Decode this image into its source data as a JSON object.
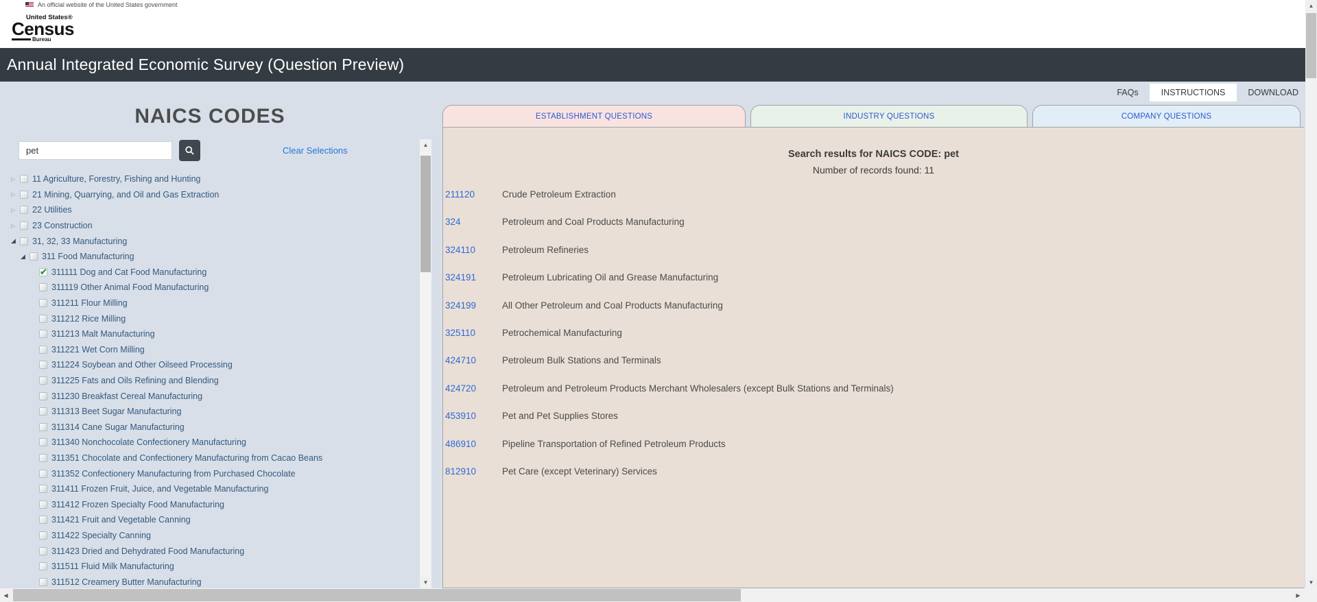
{
  "banner": {
    "text": "An official website of the United States government"
  },
  "logo": {
    "top": "United States®",
    "main": "Census",
    "sub": "Bureau"
  },
  "header": {
    "title": "Annual Integrated Economic Survey (Question Preview)"
  },
  "nav": {
    "links": [
      "FAQs",
      "INSTRUCTIONS",
      "DOWNLOAD"
    ]
  },
  "left_panel": {
    "title": "NAICS CODES",
    "search_value": "pet",
    "clear_label": "Clear Selections",
    "tree": [
      {
        "label": "11 Agriculture, Forestry, Fishing and Hunting",
        "level": 0,
        "expander": "collapsed",
        "checked": false
      },
      {
        "label": "21 Mining, Quarrying, and Oil and Gas Extraction",
        "level": 0,
        "expander": "collapsed",
        "checked": false
      },
      {
        "label": "22 Utilities",
        "level": 0,
        "expander": "collapsed",
        "checked": false
      },
      {
        "label": "23 Construction",
        "level": 0,
        "expander": "collapsed",
        "checked": false
      },
      {
        "label": "31, 32, 33 Manufacturing",
        "level": 0,
        "expander": "expanded",
        "checked": false
      },
      {
        "label": "311 Food Manufacturing",
        "level": 1,
        "expander": "expanded",
        "checked": false
      },
      {
        "label": "311111 Dog and Cat Food Manufacturing",
        "level": 2,
        "expander": null,
        "checked": true
      },
      {
        "label": "311119 Other Animal Food Manufacturing",
        "level": 2,
        "expander": null,
        "checked": false
      },
      {
        "label": "311211 Flour Milling",
        "level": 2,
        "expander": null,
        "checked": false
      },
      {
        "label": "311212 Rice Milling",
        "level": 2,
        "expander": null,
        "checked": false
      },
      {
        "label": "311213 Malt Manufacturing",
        "level": 2,
        "expander": null,
        "checked": false
      },
      {
        "label": "311221 Wet Corn Milling",
        "level": 2,
        "expander": null,
        "checked": false
      },
      {
        "label": "311224 Soybean and Other Oilseed Processing",
        "level": 2,
        "expander": null,
        "checked": false
      },
      {
        "label": "311225 Fats and Oils Refining and Blending",
        "level": 2,
        "expander": null,
        "checked": false
      },
      {
        "label": "311230 Breakfast Cereal Manufacturing",
        "level": 2,
        "expander": null,
        "checked": false
      },
      {
        "label": "311313 Beet Sugar Manufacturing",
        "level": 2,
        "expander": null,
        "checked": false
      },
      {
        "label": "311314 Cane Sugar Manufacturing",
        "level": 2,
        "expander": null,
        "checked": false
      },
      {
        "label": "311340 Nonchocolate Confectionery Manufacturing",
        "level": 2,
        "expander": null,
        "checked": false
      },
      {
        "label": "311351 Chocolate and Confectionery Manufacturing from Cacao Beans",
        "level": 2,
        "expander": null,
        "checked": false
      },
      {
        "label": "311352 Confectionery Manufacturing from Purchased Chocolate",
        "level": 2,
        "expander": null,
        "checked": false
      },
      {
        "label": "311411 Frozen Fruit, Juice, and Vegetable Manufacturing",
        "level": 2,
        "expander": null,
        "checked": false
      },
      {
        "label": "311412 Frozen Specialty Food Manufacturing",
        "level": 2,
        "expander": null,
        "checked": false
      },
      {
        "label": "311421 Fruit and Vegetable Canning",
        "level": 2,
        "expander": null,
        "checked": false
      },
      {
        "label": "311422 Specialty Canning",
        "level": 2,
        "expander": null,
        "checked": false
      },
      {
        "label": "311423 Dried and Dehydrated Food Manufacturing",
        "level": 2,
        "expander": null,
        "checked": false
      },
      {
        "label": "311511 Fluid Milk Manufacturing",
        "level": 2,
        "expander": null,
        "checked": false
      },
      {
        "label": "311512 Creamery Butter Manufacturing",
        "level": 2,
        "expander": null,
        "checked": false
      }
    ]
  },
  "tabs": [
    {
      "id": "establishment",
      "label": "ESTABLISHMENT QUESTIONS",
      "color": "#f9e3e1"
    },
    {
      "id": "industry",
      "label": "INDUSTRY QUESTIONS",
      "color": "#e9f2e8"
    },
    {
      "id": "company",
      "label": "COMPANY QUESTIONS",
      "color": "#e1eef7"
    }
  ],
  "results": {
    "heading": "Search results for NAICS CODE: pet",
    "subheading": "Number of records found: 11",
    "rows": [
      {
        "code": "211120",
        "description": "Crude Petroleum Extraction"
      },
      {
        "code": "324",
        "description": "Petroleum and Coal Products Manufacturing"
      },
      {
        "code": "324110",
        "description": "Petroleum Refineries"
      },
      {
        "code": "324191",
        "description": "Petroleum Lubricating Oil and Grease Manufacturing"
      },
      {
        "code": "324199",
        "description": "All Other Petroleum and Coal Products Manufacturing"
      },
      {
        "code": "325110",
        "description": "Petrochemical Manufacturing"
      },
      {
        "code": "424710",
        "description": "Petroleum Bulk Stations and Terminals"
      },
      {
        "code": "424720",
        "description": "Petroleum and Petroleum Products Merchant Wholesalers (except Bulk Stations and Terminals)"
      },
      {
        "code": "453910",
        "description": "Pet and Pet Supplies Stores"
      },
      {
        "code": "486910",
        "description": "Pipeline Transportation of Refined Petroleum Products"
      },
      {
        "code": "812910",
        "description": "Pet Care (except Veterinary) Services"
      }
    ]
  }
}
